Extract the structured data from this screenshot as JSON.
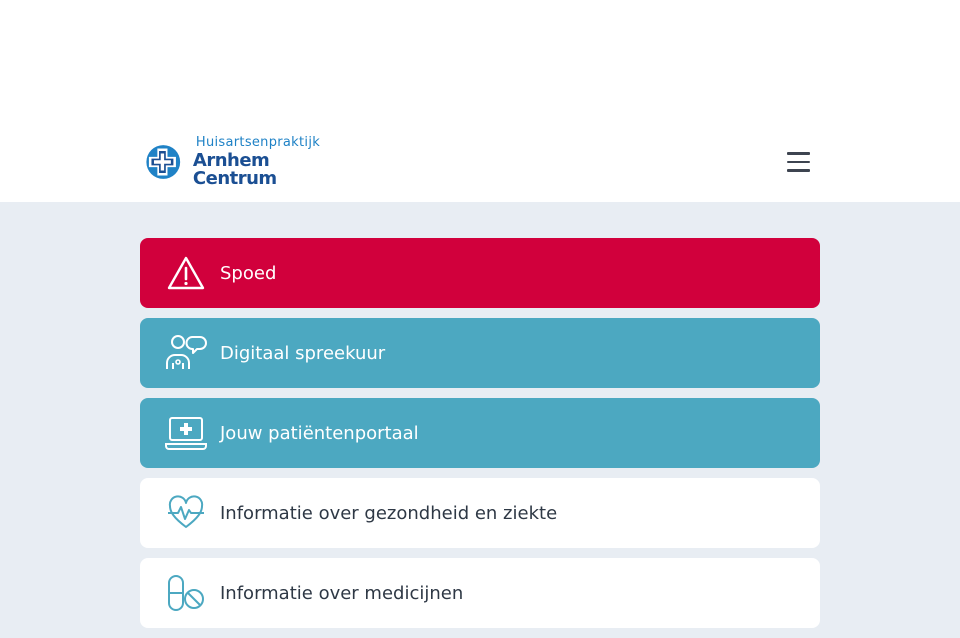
{
  "header": {
    "logo_small": "Huisartsenpraktijk",
    "logo_big": "Arnhem Centrum"
  },
  "tiles": [
    {
      "label": "Spoed",
      "icon": "warning-icon"
    },
    {
      "label": "Digitaal spreekuur",
      "icon": "chat-people-icon"
    },
    {
      "label": "Jouw patiëntenportaal",
      "icon": "laptop-medical-icon"
    },
    {
      "label": "Informatie over gezondheid en ziekte",
      "icon": "heartbeat-icon"
    },
    {
      "label": "Informatie over medicijnen",
      "icon": "pill-icon"
    }
  ],
  "colors": {
    "accent_red": "#d1003c",
    "accent_teal": "#4ca8c1",
    "icon_teal": "#4ca8c1",
    "page_bg": "#e8edf3"
  }
}
